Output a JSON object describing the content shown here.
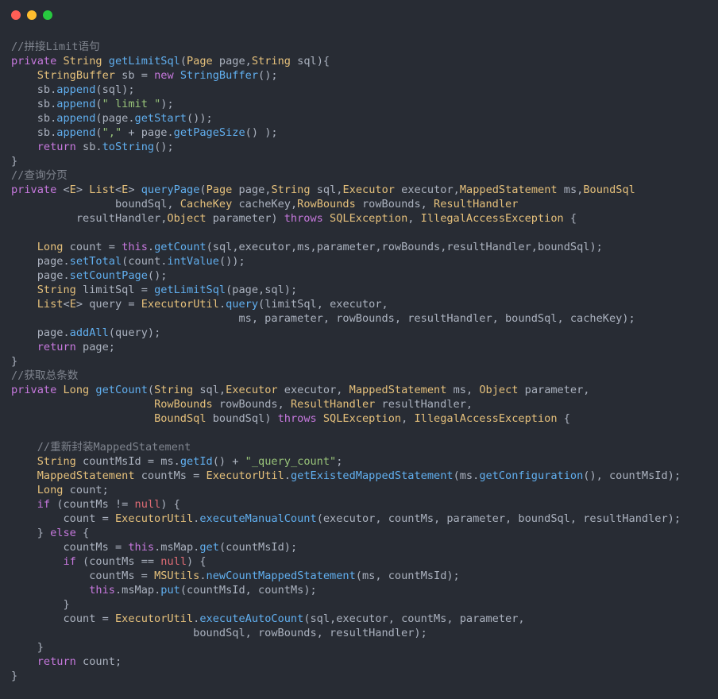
{
  "window": {
    "controls": [
      "close",
      "minimize",
      "zoom"
    ]
  },
  "theme": {
    "background": "#282c34",
    "plain": "#abb2bf",
    "keyword": "#c678dd",
    "type": "#e5c07b",
    "function": "#61afef",
    "string": "#98c379",
    "comment": "#7f848e",
    "literal": "#e06c75"
  },
  "code": {
    "lines": [
      [
        [
          "cm",
          "//拼接Limit语句"
        ]
      ],
      [
        [
          "kw",
          "private "
        ],
        [
          "ty",
          "String "
        ],
        [
          "fn",
          "getLimitSql"
        ],
        [
          "pl",
          "("
        ],
        [
          "ty",
          "Page "
        ],
        [
          "pl",
          "page,"
        ],
        [
          "ty",
          "String "
        ],
        [
          "pl",
          "sql){"
        ]
      ],
      [
        [
          "pl",
          "    "
        ],
        [
          "ty",
          "StringBuffer "
        ],
        [
          "pl",
          "sb = "
        ],
        [
          "kw",
          "new "
        ],
        [
          "fn",
          "StringBuffer"
        ],
        [
          "pl",
          "();"
        ]
      ],
      [
        [
          "pl",
          "    sb."
        ],
        [
          "fn",
          "append"
        ],
        [
          "pl",
          "(sql);"
        ]
      ],
      [
        [
          "pl",
          "    sb."
        ],
        [
          "fn",
          "append"
        ],
        [
          "pl",
          "("
        ],
        [
          "str",
          "\" limit \""
        ],
        [
          "pl",
          ");"
        ]
      ],
      [
        [
          "pl",
          "    sb."
        ],
        [
          "fn",
          "append"
        ],
        [
          "pl",
          "(page."
        ],
        [
          "fn",
          "getStart"
        ],
        [
          "pl",
          "());"
        ]
      ],
      [
        [
          "pl",
          "    sb."
        ],
        [
          "fn",
          "append"
        ],
        [
          "pl",
          "("
        ],
        [
          "str",
          "\",\""
        ],
        [
          "pl",
          " + page."
        ],
        [
          "fn",
          "getPageSize"
        ],
        [
          "pl",
          "() );"
        ]
      ],
      [
        [
          "pl",
          "    "
        ],
        [
          "kw",
          "return "
        ],
        [
          "pl",
          "sb."
        ],
        [
          "fn",
          "toString"
        ],
        [
          "pl",
          "();"
        ]
      ],
      [
        [
          "pl",
          "}"
        ]
      ],
      [
        [
          "cm",
          "//查询分页"
        ]
      ],
      [
        [
          "kw",
          "private "
        ],
        [
          "pl",
          "<"
        ],
        [
          "ty",
          "E"
        ],
        [
          "pl",
          "> "
        ],
        [
          "ty",
          "List"
        ],
        [
          "pl",
          "<"
        ],
        [
          "ty",
          "E"
        ],
        [
          "pl",
          "> "
        ],
        [
          "fn",
          "queryPage"
        ],
        [
          "pl",
          "("
        ],
        [
          "ty",
          "Page "
        ],
        [
          "pl",
          "page,"
        ],
        [
          "ty",
          "String "
        ],
        [
          "pl",
          "sql,"
        ],
        [
          "ty",
          "Executor "
        ],
        [
          "pl",
          "executor,"
        ],
        [
          "ty",
          "MappedStatement "
        ],
        [
          "pl",
          "ms,"
        ],
        [
          "ty",
          "BoundSql"
        ]
      ],
      [
        [
          "pl",
          "                "
        ],
        [
          "pl",
          "boundSql, "
        ],
        [
          "ty",
          "CacheKey "
        ],
        [
          "pl",
          "cacheKey,"
        ],
        [
          "ty",
          "RowBounds "
        ],
        [
          "pl",
          "rowBounds, "
        ],
        [
          "ty",
          "ResultHandler"
        ]
      ],
      [
        [
          "pl",
          "          resultHandler,"
        ],
        [
          "ty",
          "Object "
        ],
        [
          "pl",
          "parameter) "
        ],
        [
          "kw",
          "throws "
        ],
        [
          "ty",
          "SQLException"
        ],
        [
          "pl",
          ", "
        ],
        [
          "ty",
          "IllegalAccessException "
        ],
        [
          "pl",
          "{"
        ]
      ],
      [
        [
          "pl",
          " "
        ]
      ],
      [
        [
          "pl",
          "    "
        ],
        [
          "ty",
          "Long "
        ],
        [
          "pl",
          "count = "
        ],
        [
          "kw",
          "this"
        ],
        [
          "pl",
          "."
        ],
        [
          "fn",
          "getCount"
        ],
        [
          "pl",
          "(sql,executor,ms,parameter,rowBounds,resultHandler,boundSql);"
        ]
      ],
      [
        [
          "pl",
          "    page."
        ],
        [
          "fn",
          "setTotal"
        ],
        [
          "pl",
          "(count."
        ],
        [
          "fn",
          "intValue"
        ],
        [
          "pl",
          "());"
        ]
      ],
      [
        [
          "pl",
          "    page."
        ],
        [
          "fn",
          "setCountPage"
        ],
        [
          "pl",
          "();"
        ]
      ],
      [
        [
          "pl",
          "    "
        ],
        [
          "ty",
          "String "
        ],
        [
          "pl",
          "limitSql = "
        ],
        [
          "fn",
          "getLimitSql"
        ],
        [
          "pl",
          "(page,sql);"
        ]
      ],
      [
        [
          "pl",
          "    "
        ],
        [
          "ty",
          "List"
        ],
        [
          "pl",
          "<"
        ],
        [
          "ty",
          "E"
        ],
        [
          "pl",
          "> query = "
        ],
        [
          "ty",
          "ExecutorUtil"
        ],
        [
          "pl",
          "."
        ],
        [
          "fn",
          "query"
        ],
        [
          "pl",
          "(limitSql, executor,"
        ]
      ],
      [
        [
          "pl",
          "                                   ms, parameter, rowBounds, resultHandler, boundSql, cacheKey);"
        ]
      ],
      [
        [
          "pl",
          "    page."
        ],
        [
          "fn",
          "addAll"
        ],
        [
          "pl",
          "(query);"
        ]
      ],
      [
        [
          "pl",
          "    "
        ],
        [
          "kw",
          "return "
        ],
        [
          "pl",
          "page;"
        ]
      ],
      [
        [
          "pl",
          "}"
        ]
      ],
      [
        [
          "cm",
          "//获取总条数"
        ]
      ],
      [
        [
          "kw",
          "private "
        ],
        [
          "ty",
          "Long "
        ],
        [
          "fn",
          "getCount"
        ],
        [
          "pl",
          "("
        ],
        [
          "ty",
          "String "
        ],
        [
          "pl",
          "sql,"
        ],
        [
          "ty",
          "Executor "
        ],
        [
          "pl",
          "executor, "
        ],
        [
          "ty",
          "MappedStatement "
        ],
        [
          "pl",
          "ms, "
        ],
        [
          "ty",
          "Object "
        ],
        [
          "pl",
          "parameter,"
        ]
      ],
      [
        [
          "pl",
          "                      "
        ],
        [
          "ty",
          "RowBounds "
        ],
        [
          "pl",
          "rowBounds, "
        ],
        [
          "ty",
          "ResultHandler "
        ],
        [
          "pl",
          "resultHandler,"
        ]
      ],
      [
        [
          "pl",
          "                      "
        ],
        [
          "ty",
          "BoundSql "
        ],
        [
          "pl",
          "boundSql) "
        ],
        [
          "kw",
          "throws "
        ],
        [
          "ty",
          "SQLException"
        ],
        [
          "pl",
          ", "
        ],
        [
          "ty",
          "IllegalAccessException "
        ],
        [
          "pl",
          "{"
        ]
      ],
      [
        [
          "pl",
          " "
        ]
      ],
      [
        [
          "pl",
          "    "
        ],
        [
          "cm",
          "//重新封装MappedStatement"
        ]
      ],
      [
        [
          "pl",
          "    "
        ],
        [
          "ty",
          "String "
        ],
        [
          "pl",
          "countMsId = ms."
        ],
        [
          "fn",
          "getId"
        ],
        [
          "pl",
          "() + "
        ],
        [
          "str",
          "\"_query_count\""
        ],
        [
          "pl",
          ";"
        ]
      ],
      [
        [
          "pl",
          "    "
        ],
        [
          "ty",
          "MappedStatement "
        ],
        [
          "pl",
          "countMs = "
        ],
        [
          "ty",
          "ExecutorUtil"
        ],
        [
          "pl",
          "."
        ],
        [
          "fn",
          "getExistedMappedStatement"
        ],
        [
          "pl",
          "(ms."
        ],
        [
          "fn",
          "getConfiguration"
        ],
        [
          "pl",
          "(), countMsId);"
        ]
      ],
      [
        [
          "pl",
          "    "
        ],
        [
          "ty",
          "Long "
        ],
        [
          "pl",
          "count;"
        ]
      ],
      [
        [
          "pl",
          "    "
        ],
        [
          "kw",
          "if "
        ],
        [
          "pl",
          "(countMs != "
        ],
        [
          "lit",
          "null"
        ],
        [
          "pl",
          ") {"
        ]
      ],
      [
        [
          "pl",
          "        count = "
        ],
        [
          "ty",
          "ExecutorUtil"
        ],
        [
          "pl",
          "."
        ],
        [
          "fn",
          "executeManualCount"
        ],
        [
          "pl",
          "(executor, countMs, parameter, boundSql, resultHandler);"
        ]
      ],
      [
        [
          "pl",
          "    } "
        ],
        [
          "kw",
          "else "
        ],
        [
          "pl",
          "{"
        ]
      ],
      [
        [
          "pl",
          "        countMs = "
        ],
        [
          "kw",
          "this"
        ],
        [
          "pl",
          ".msMap."
        ],
        [
          "fn",
          "get"
        ],
        [
          "pl",
          "(countMsId);"
        ]
      ],
      [
        [
          "pl",
          "        "
        ],
        [
          "kw",
          "if "
        ],
        [
          "pl",
          "(countMs == "
        ],
        [
          "lit",
          "null"
        ],
        [
          "pl",
          ") {"
        ]
      ],
      [
        [
          "pl",
          "            countMs = "
        ],
        [
          "ty",
          "MSUtils"
        ],
        [
          "pl",
          "."
        ],
        [
          "fn",
          "newCountMappedStatement"
        ],
        [
          "pl",
          "(ms, countMsId);"
        ]
      ],
      [
        [
          "pl",
          "            "
        ],
        [
          "kw",
          "this"
        ],
        [
          "pl",
          ".msMap."
        ],
        [
          "fn",
          "put"
        ],
        [
          "pl",
          "(countMsId, countMs);"
        ]
      ],
      [
        [
          "pl",
          "        }"
        ]
      ],
      [
        [
          "pl",
          "        count = "
        ],
        [
          "ty",
          "ExecutorUtil"
        ],
        [
          "pl",
          "."
        ],
        [
          "fn",
          "executeAutoCount"
        ],
        [
          "pl",
          "(sql,executor, countMs, parameter,"
        ]
      ],
      [
        [
          "pl",
          "                            boundSql, rowBounds, resultHandler);"
        ]
      ],
      [
        [
          "pl",
          "    }"
        ]
      ],
      [
        [
          "pl",
          "    "
        ],
        [
          "kw",
          "return "
        ],
        [
          "pl",
          "count;"
        ]
      ],
      [
        [
          "pl",
          "}"
        ]
      ]
    ]
  }
}
